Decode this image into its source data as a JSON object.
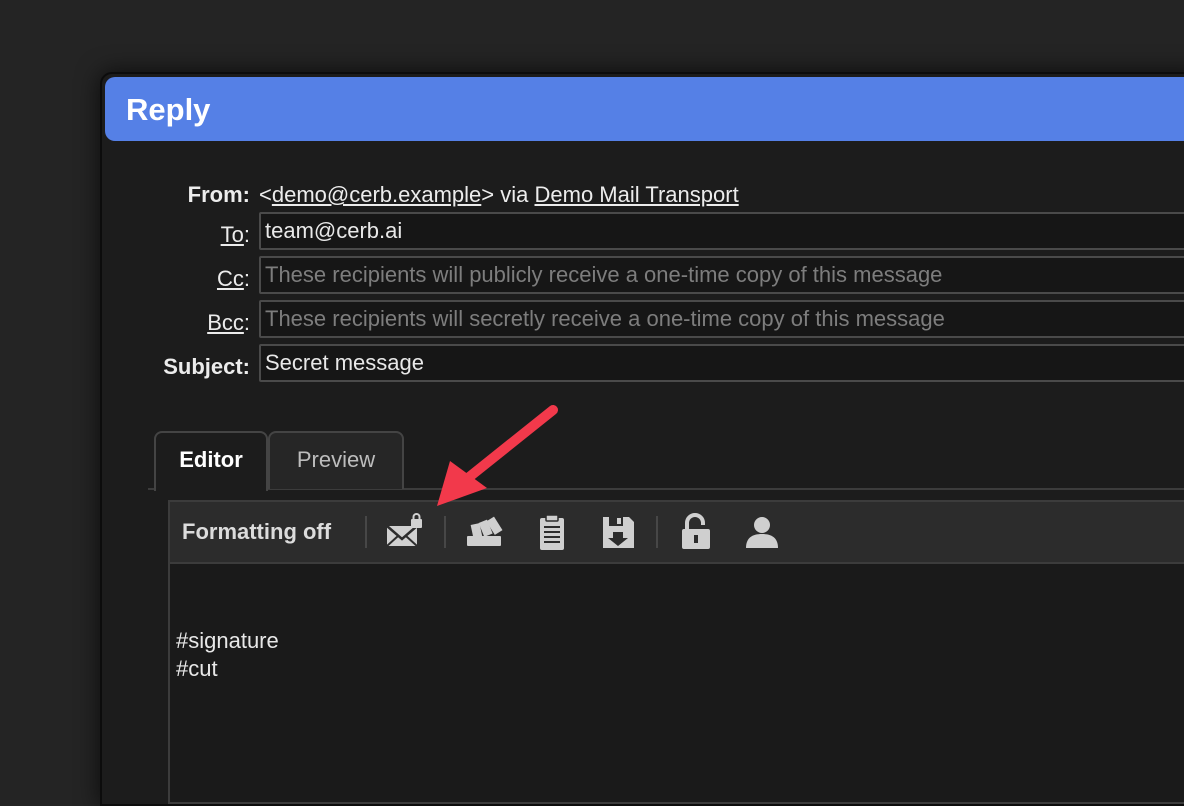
{
  "dialog": {
    "title": "Reply",
    "accent_color": "#5580e6"
  },
  "from": {
    "label": "From:",
    "prefix": "<",
    "address": "demo@cerb.example",
    "suffix": "> via ",
    "transport": "Demo Mail Transport"
  },
  "to": {
    "label": "To",
    "colon": ":",
    "value": "team@cerb.ai"
  },
  "cc": {
    "label": "Cc",
    "colon": ":",
    "placeholder": "These recipients will publicly receive a one-time copy of this message"
  },
  "bcc": {
    "label": "Bcc",
    "colon": ":",
    "placeholder": "These recipients will secretly receive a one-time copy of this message"
  },
  "subject": {
    "label": "Subject:",
    "value": "Secret message"
  },
  "tabs": [
    {
      "label": "Editor",
      "active": true
    },
    {
      "label": "Preview",
      "active": false
    }
  ],
  "toolbar": {
    "formatting_label": "Formatting off",
    "icons": [
      "encrypt-mail-icon",
      "snippets-icon",
      "clipboard-icon",
      "save-draft-icon",
      "unlock-icon",
      "user-icon"
    ]
  },
  "editor": {
    "lines": [
      "#signature",
      "#cut"
    ]
  },
  "annotation": {
    "arrow_color": "#f2394b"
  }
}
